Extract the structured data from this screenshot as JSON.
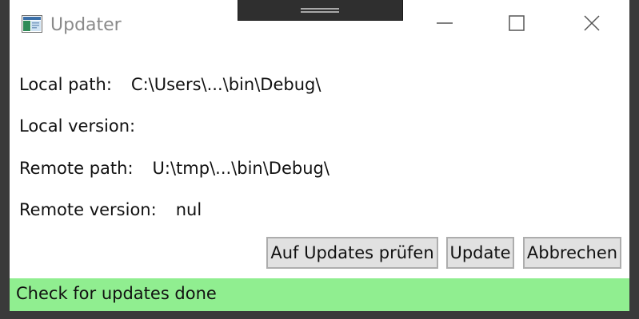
{
  "window": {
    "title": "Updater",
    "icon": "app-window-icon"
  },
  "caption_buttons": {
    "minimize_icon": "minimize-icon",
    "maximize_icon": "maximize-icon",
    "close_icon": "close-icon"
  },
  "fields": {
    "local_path_label": "Local path:",
    "local_path_value": "C:\\Users\\...\\bin\\Debug\\",
    "local_version_label": "Local version:",
    "local_version_value": "",
    "remote_path_label": "Remote path:",
    "remote_path_value": "U:\\tmp\\...\\bin\\Debug\\",
    "remote_version_label": "Remote version:",
    "remote_version_value": "nul"
  },
  "buttons": {
    "check_label": "Auf Updates prüfen",
    "update_label": "Update",
    "cancel_label": "Abbrechen"
  },
  "status": {
    "text": "Check for updates done",
    "color": "#90ee90"
  }
}
